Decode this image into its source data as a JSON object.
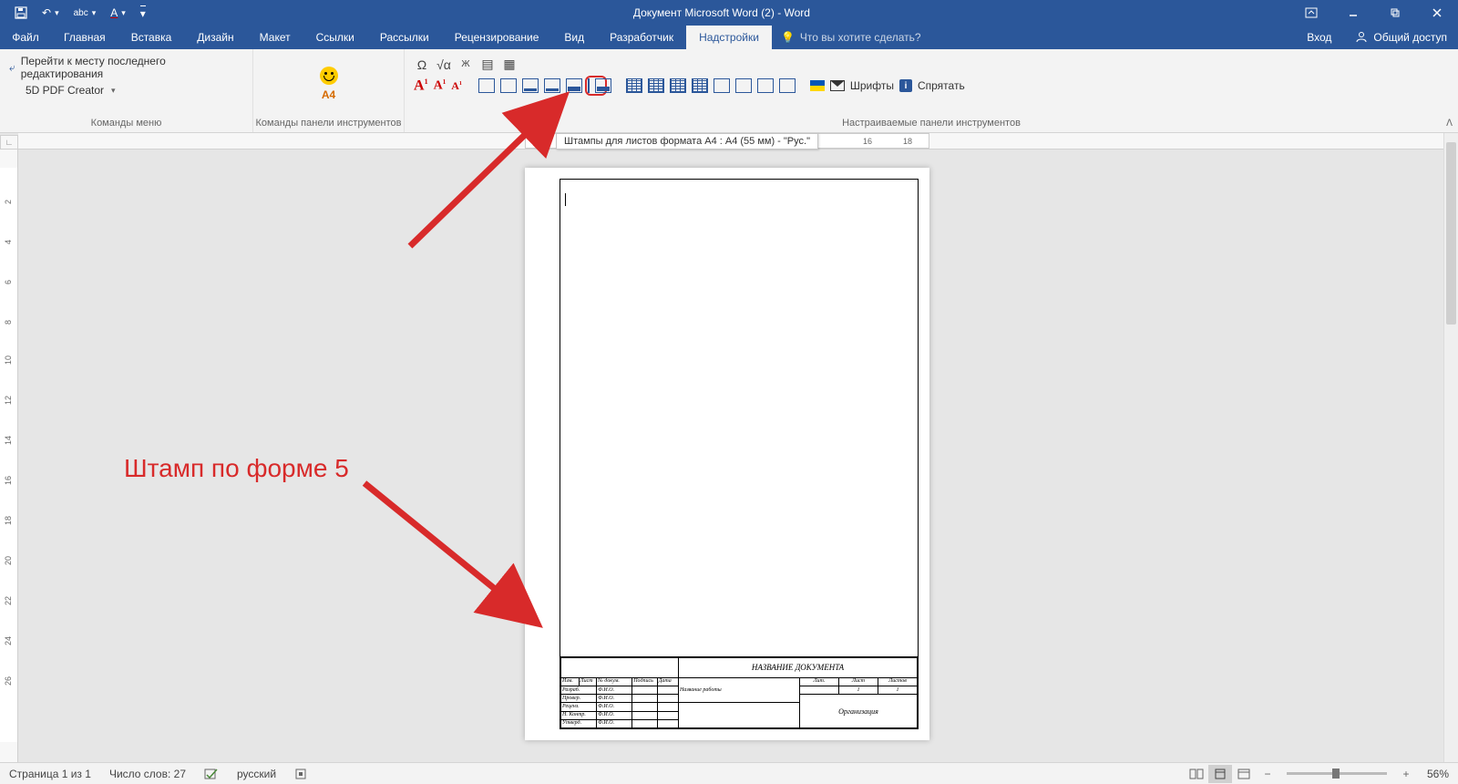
{
  "title": "Документ Microsoft Word (2) - Word",
  "tabs": {
    "file": "Файл",
    "items": [
      "Главная",
      "Вставка",
      "Дизайн",
      "Макет",
      "Ссылки",
      "Рассылки",
      "Рецензирование",
      "Вид",
      "Разработчик",
      "Надстройки"
    ],
    "active_index": 9,
    "tellme_placeholder": "Что вы хотите сделать?",
    "signin": "Вход",
    "share": "Общий доступ"
  },
  "ribbon": {
    "group1": {
      "return_edit": "Перейти к месту последнего редактирования",
      "pdf": "5D PDF Creator",
      "label": "Команды меню"
    },
    "group2": {
      "a4": "А4",
      "label": "Команды панели инструментов"
    },
    "group3": {
      "fonts": "Шрифты",
      "hide": "Спрятать",
      "label": "Настраиваемые панели инструментов"
    }
  },
  "tooltip": "Штампы для листов формата А4 : А4 (55 мм) - \"Рус.\"",
  "hruler_right": [
    "16",
    "18"
  ],
  "vruler": [
    "2",
    "4",
    "6",
    "8",
    "10",
    "12",
    "14",
    "16",
    "18",
    "20",
    "22",
    "24",
    "26"
  ],
  "annotation_text": "Штамп по форме 5",
  "stamp": {
    "doc_title": "НАЗВАНИЕ ДОКУМЕНТА",
    "work_name": "Название работы",
    "org": "Организация",
    "headers": [
      "Изм.",
      "Лист",
      "№ докум.",
      "Подпись",
      "Дата"
    ],
    "rows": [
      "Разраб.",
      "Провер.",
      "Реценз.",
      "Н. Контр.",
      "Утверд."
    ],
    "fio": "Ф.И.О.",
    "cols2": [
      "Лит.",
      "Лист",
      "Листов"
    ],
    "page": "1",
    "pages": "1"
  },
  "status": {
    "page": "Страница 1 из 1",
    "words": "Число слов: 27",
    "lang": "русский",
    "zoom": "56%"
  }
}
